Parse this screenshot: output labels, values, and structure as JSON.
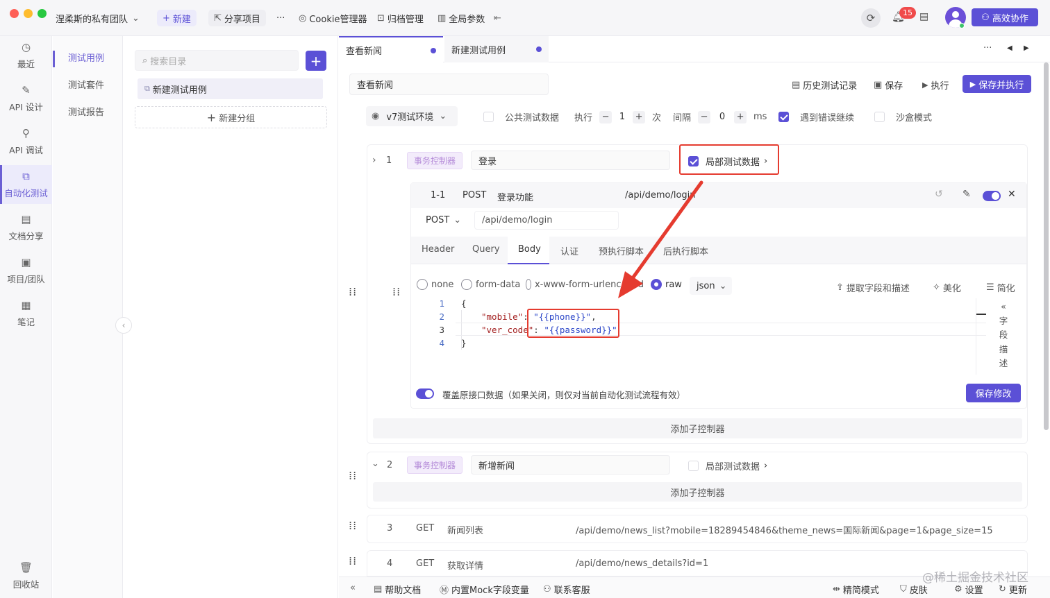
{
  "titlebar": {
    "team_name": "涅柔斯的私有团队",
    "new_label": "新建",
    "share_label": "分享项目",
    "more_label": "···",
    "cookie_label": "Cookie管理器",
    "archive_label": "归档管理",
    "global_params_label": "全局参数",
    "notification_count": "15",
    "collab_label": "高效协作"
  },
  "leftnav": {
    "items": [
      {
        "label": "最近"
      },
      {
        "label": "API 设计"
      },
      {
        "label": "API 调试"
      },
      {
        "label": "自动化测试"
      },
      {
        "label": "文档分享"
      },
      {
        "label": "项目/团队"
      },
      {
        "label": "笔记"
      }
    ],
    "trash_label": "回收站"
  },
  "subnav": {
    "items": [
      {
        "label": "测试用例"
      },
      {
        "label": "测试套件"
      },
      {
        "label": "测试报告"
      }
    ]
  },
  "tree": {
    "search_placeholder": "搜索目录",
    "add_label": "+",
    "items": [
      {
        "label": "新建测试用例"
      }
    ],
    "new_group_label": "新建分组"
  },
  "tabs": [
    {
      "label": "查看新闻"
    },
    {
      "label": "新建测试用例"
    }
  ],
  "case": {
    "name": "查看新闻",
    "history_label": "历史测试记录",
    "save_label": "保存",
    "run_label": "执行",
    "save_run_label": "保存并执行"
  },
  "options": {
    "env": "v7测试环境",
    "public_data_label": "公共测试数据",
    "run_label": "执行",
    "run_count": "1",
    "times_label": "次",
    "interval_label": "间隔",
    "interval_value": "0",
    "ms_label": "ms",
    "continue_on_error_label": "遇到错误继续",
    "sandbox_label": "沙盒模式"
  },
  "steps": {
    "step1": {
      "num": "1",
      "tag": "事务控制器",
      "name": "登录",
      "local_data_label": "局部测试数据"
    },
    "api": {
      "id": "1-1",
      "method": "POST",
      "name": "登录功能",
      "path": "/api/demo/login",
      "method_select": "POST",
      "url": "/api/demo/login",
      "subtabs": [
        "Header",
        "Query",
        "Body",
        "认证",
        "预执行脚本",
        "后执行脚本"
      ],
      "body_types": [
        "none",
        "form-data",
        "x-www-form-urlencoded",
        "raw"
      ],
      "raw_format": "json",
      "extract_label": "提取字段和描述",
      "beautify_label": "美化",
      "simplify_label": "简化",
      "field_desc_label": [
        "字",
        "段",
        "描",
        "述"
      ],
      "code_lines": [
        "1",
        "2",
        "3",
        "4"
      ],
      "code": {
        "open": "{",
        "k1": "\"mobile\"",
        "v1": "\"{{phone}}\"",
        "k2": "\"ver_code\"",
        "v2": "\"{{password}}\"",
        "close": "}"
      },
      "override_label": "覆盖原接口数据（如果关闭，则仅对当前自动化测试流程有效）",
      "save_changes_label": "保存修改"
    },
    "add_child_label": "添加子控制器",
    "step2": {
      "num": "2",
      "tag": "事务控制器",
      "name": "新增新闻",
      "local_data_label": "局部测试数据"
    },
    "step3": {
      "num": "3",
      "method": "GET",
      "name": "新闻列表",
      "url": "/api/demo/news_list?mobile=18289454846&theme_news=国际新闻&page=1&page_size=15"
    },
    "step4": {
      "num": "4",
      "method": "GET",
      "name": "获取详情",
      "url": "/api/demo/news_details?id=1"
    }
  },
  "bottombar": {
    "help_label": "帮助文档",
    "mock_label": "内置Mock字段变量",
    "support_label": "联系客服",
    "simple_mode_label": "精简模式",
    "skin_label": "皮肤",
    "settings_label": "设置",
    "update_label": "更新",
    "watermark": "@稀土掘金技术社区"
  },
  "colors": {
    "accent": "#5b50d6",
    "highlight": "#e53b2f"
  }
}
